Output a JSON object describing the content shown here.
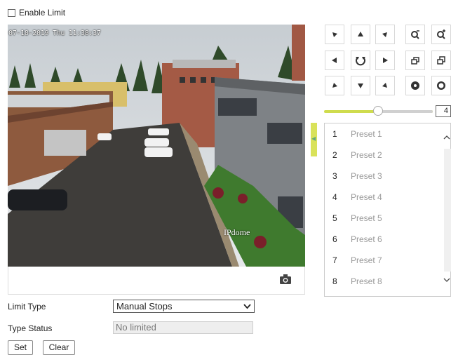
{
  "limit": {
    "checkbox_label": "Enable Limit",
    "checked": false
  },
  "video": {
    "osd_time": "07-18-2019 Thu 11:38:37",
    "osd_name": "IPdome",
    "snapshot_icon": "camera-icon"
  },
  "ptz": {
    "speed": "4",
    "speed_level_fraction": 0.5,
    "buttons": [
      {
        "name": "pan-up-left-button",
        "icon": "arrow-up-left-icon"
      },
      {
        "name": "pan-up-button",
        "icon": "arrow-up-icon"
      },
      {
        "name": "pan-up-right-button",
        "icon": "arrow-up-right-icon"
      },
      {
        "name": "pan-left-button",
        "icon": "arrow-left-icon"
      },
      {
        "name": "auto-pan-button",
        "icon": "rotate-icon"
      },
      {
        "name": "pan-right-button",
        "icon": "arrow-right-icon"
      },
      {
        "name": "pan-down-left-button",
        "icon": "arrow-down-left-icon"
      },
      {
        "name": "pan-down-button",
        "icon": "arrow-down-icon"
      },
      {
        "name": "pan-down-right-button",
        "icon": "arrow-down-right-icon"
      },
      {
        "name": "zoom-out-button",
        "icon": "zoom-out-icon"
      },
      {
        "name": "zoom-in-button",
        "icon": "zoom-in-icon"
      },
      {
        "name": "focus-near-button",
        "icon": "focus-near-icon"
      },
      {
        "name": "focus-far-button",
        "icon": "focus-far-icon"
      },
      {
        "name": "iris-close-button",
        "icon": "iris-close-icon"
      },
      {
        "name": "iris-open-button",
        "icon": "iris-open-icon"
      }
    ]
  },
  "presets": [
    {
      "num": "1",
      "name": "Preset 1"
    },
    {
      "num": "2",
      "name": "Preset 2"
    },
    {
      "num": "3",
      "name": "Preset 3"
    },
    {
      "num": "4",
      "name": "Preset 4"
    },
    {
      "num": "5",
      "name": "Preset 5"
    },
    {
      "num": "6",
      "name": "Preset 6"
    },
    {
      "num": "7",
      "name": "Preset 7"
    },
    {
      "num": "8",
      "name": "Preset 8"
    }
  ],
  "form": {
    "limit_type_label": "Limit Type",
    "limit_type_value": "Manual Stops",
    "type_status_label": "Type Status",
    "type_status_value": "No limited",
    "set_label": "Set",
    "clear_label": "Clear"
  },
  "colors": {
    "accent": "#d9e25a"
  }
}
